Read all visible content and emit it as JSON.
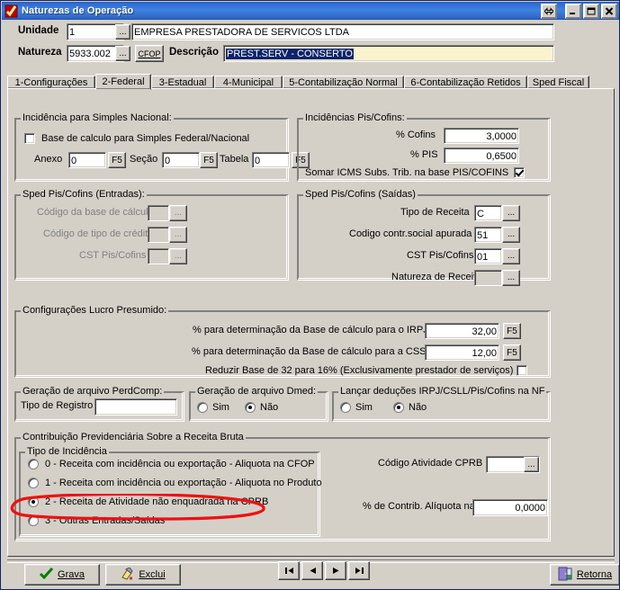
{
  "window": {
    "title": "Naturezas de Operação",
    "icon": "checkmark-icon",
    "buttons": {
      "resize": "⇔",
      "minimize": "_",
      "maximize": "□",
      "close": "✕"
    }
  },
  "header": {
    "unidade_label": "Unidade",
    "unidade_value": "1",
    "unidade_name": "EMPRESA PRESTADORA DE SERVICOS LTDA",
    "natureza_label": "Natureza",
    "natureza_value": "5933.002",
    "cfop_button": "CFOP",
    "descricao_label": "Descrição",
    "descricao_value": "PREST.SERV - CONSERTO",
    "ellipsis": "..."
  },
  "tabs": [
    {
      "label": "1-Configurações",
      "accel": "1",
      "active": false
    },
    {
      "label": "2-Federal",
      "accel": "2",
      "active": true
    },
    {
      "label": "3-Estadual",
      "accel": "3",
      "active": false
    },
    {
      "label": "4-Municipal",
      "accel": "4",
      "active": false
    },
    {
      "label": "5-Contabilização Normal",
      "accel": "5",
      "active": false
    },
    {
      "label": "6-Contabilização Retidos",
      "accel": "6",
      "active": false
    },
    {
      "label": "Sped Fiscal",
      "accel": "",
      "active": false
    }
  ],
  "simples": {
    "group_title": "Incidência para Simples Nacional:",
    "base_checkbox_label": "Base de calculo para Simples Federal/Nacional",
    "base_checked": false,
    "anexo_label": "Anexo",
    "anexo_value": "0",
    "secao_label": "Seção",
    "secao_value": "0",
    "tabela_label": "Tabela",
    "tabela_value": "0",
    "f5": "F5"
  },
  "pis_cofins": {
    "group_title": "Incidências Pis/Cofins:",
    "cofins_label": "% Cofins",
    "cofins_value": "3,0000",
    "pis_label": "% PIS",
    "pis_value": "0,6500",
    "somar_label": "Somar ICMS Subs. Trib. na base PIS/COFINS",
    "somar_checked": true
  },
  "sped_entradas": {
    "group_title": "Sped Pis/Cofins (Entradas):",
    "base_calculo_label": "Código da base de cálculo",
    "base_calculo_value": "",
    "tipo_credito_label": "Código de tipo de crédito",
    "tipo_credito_value": "",
    "cst_label": "CST Pis/Cofins",
    "cst_value": "",
    "ellipsis": "..."
  },
  "sped_saidas": {
    "group_title": "Sped Pis/Cofins (Saídas)",
    "tipo_receita_label": "Tipo de Receita",
    "tipo_receita_value": "C",
    "codigo_contr_label": "Codigo contr.social apurada",
    "codigo_contr_value": "51",
    "cst_label": "CST Pis/Cofins",
    "cst_value": "01",
    "natureza_receita_label": "Natureza de Receita",
    "natureza_receita_value": "",
    "ellipsis": "..."
  },
  "lucro_presumido": {
    "group_title": "Configurações Lucro Presumido:",
    "irpj_label": "% para determinação da Base de cálculo para o IRPJ",
    "irpj_value": "32,00",
    "cssl_label": "% para determinação da Base de cálculo para a CSSL",
    "cssl_value": "12,00",
    "reduzir_label": "Reduzir Base de 32 para 16% (Exclusivamente prestador de serviços)",
    "reduzir_checked": false,
    "f5": "F5"
  },
  "perdcomp": {
    "group_title": "Geração de arquivo PerdComp:",
    "tipo_registro_label": "Tipo de Registro",
    "tipo_registro_value": ""
  },
  "dmed": {
    "group_title": "Geração de arquivo Dmed:",
    "sim_label": "Sim",
    "nao_label": "Não",
    "selected": "Não"
  },
  "lancar_deducoes": {
    "group_title": "Lançar deduções IRPJ/CSLL/Pis/Cofins na NF",
    "sim_label": "Sim",
    "nao_label": "Não",
    "selected": "Não"
  },
  "cprb": {
    "group_title": "Contribuição Previdenciária Sobre a Receita Bruta",
    "tipo_group_title": "Tipo de Incidência",
    "options": [
      {
        "label": "0 - Receita com incidência ou exportação - Aliquota na CFOP",
        "selected": false
      },
      {
        "label": "1 - Receita com incidência ou exportação - Aliquota no Produto",
        "selected": false
      },
      {
        "label": "2 - Receita de Atividade não enquadrada na CPRB",
        "selected": true
      },
      {
        "label": "3 - Outras Entradas/Saídas",
        "selected": false
      }
    ],
    "codigo_atividade_label": "Código Atividade CPRB",
    "codigo_atividade_value": "",
    "contrib_label": "% de Contrib. Alíquota na CFOP",
    "contrib_value": "0,0000",
    "ellipsis": "...",
    "annotation_color": "#ee1111"
  },
  "footer": {
    "grava_label": "Grava",
    "exclui_label": "Excluir",
    "exclui_text": "Exclui",
    "retorna_label": "Retorna",
    "nav_first": "|◀",
    "nav_prev": "◀",
    "nav_next": "▶",
    "nav_last": "▶|"
  },
  "colors": {
    "face": "#d4d0c8",
    "titlebar": "#2e6ad1",
    "field": "#ffffff",
    "highlight_field": "#faf3cd",
    "selection": "#0a246a",
    "disabled_text": "#808080",
    "annotation": "#ee1111"
  }
}
